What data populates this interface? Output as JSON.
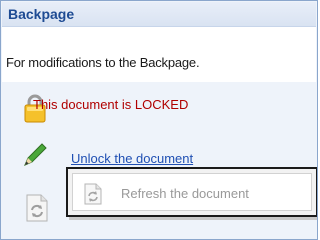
{
  "panel": {
    "title": "Backpage",
    "description": "For modifications to the Backpage.",
    "lock_status": "This document is LOCKED",
    "unlock_link": "Unlock the document",
    "refresh_label": "Refresh the document"
  },
  "icons": {
    "lock": "lock-icon",
    "pencil": "pencil-icon",
    "refresh": "refresh-icon"
  },
  "colors": {
    "title": "#1e4b93",
    "locked_text": "#b00000",
    "link": "#1f4fb3",
    "disabled_text": "#999999"
  }
}
